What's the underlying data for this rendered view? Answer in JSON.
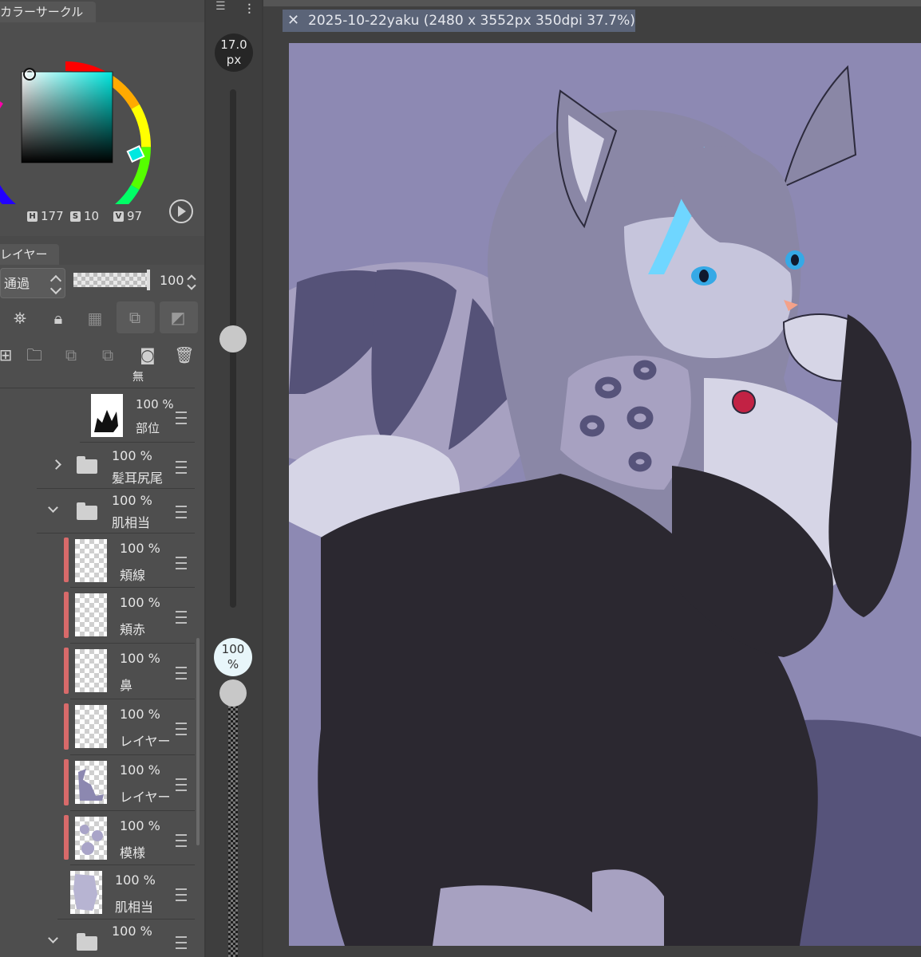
{
  "color_panel": {
    "tab_label": "カラーサークル",
    "h_label": "H",
    "h_value": "177",
    "s_label": "S",
    "s_value": "10",
    "v_label": "V",
    "v_value": "97",
    "current_color": "#35d8d3"
  },
  "layer_panel": {
    "tab_label": "レイヤー",
    "blend_mode": "通過",
    "opacity": "100",
    "layers": [
      {
        "id": "l0",
        "name": "無",
        "percent": "",
        "kind": "partial"
      },
      {
        "id": "l1",
        "name": "部位",
        "percent": "100 %",
        "kind": "layer"
      },
      {
        "id": "l2",
        "name": "髪耳尻尾",
        "percent": "100 %",
        "kind": "folder-closed"
      },
      {
        "id": "l3",
        "name": "肌相当",
        "percent": "100 %",
        "kind": "folder-open"
      },
      {
        "id": "l4",
        "name": "頬線",
        "percent": "100 %",
        "kind": "layer"
      },
      {
        "id": "l5",
        "name": "頬赤",
        "percent": "100 %",
        "kind": "layer"
      },
      {
        "id": "l6",
        "name": "鼻",
        "percent": "100 %",
        "kind": "layer"
      },
      {
        "id": "l7",
        "name": "レイヤー",
        "percent": "100 %",
        "kind": "layer"
      },
      {
        "id": "l8",
        "name": "レイヤー",
        "percent": "100 %",
        "kind": "layer"
      },
      {
        "id": "l9",
        "name": "模様",
        "percent": "100 %",
        "kind": "layer"
      },
      {
        "id": "l10",
        "name": "肌相当",
        "percent": "100 %",
        "kind": "layer"
      },
      {
        "id": "l11",
        "name": "",
        "percent": "100 %",
        "kind": "folder-open"
      }
    ]
  },
  "brush": {
    "size_value": "17.0",
    "size_unit": "px",
    "opacity_value": "100",
    "opacity_unit": "%"
  },
  "document": {
    "tab_title": "2025-10-22yaku (2480 x 3552px 350dpi 37.7%)",
    "background_color": "#8d89b3"
  },
  "icons": [
    "close-icon",
    "play-icon",
    "lock-icon",
    "folder-icon",
    "trash-icon",
    "menu-icon",
    "chevron-down-icon",
    "chevron-right-icon"
  ]
}
